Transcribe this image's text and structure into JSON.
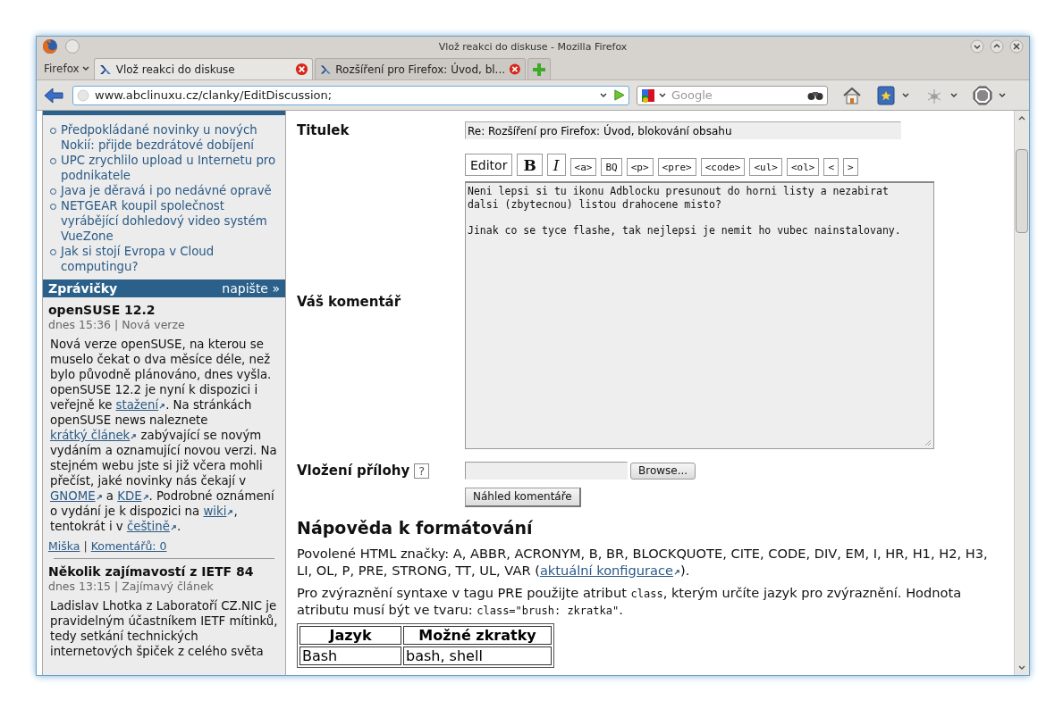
{
  "window": {
    "title": "Vlož reakci do diskuse - Mozilla Firefox"
  },
  "menu_button": "Firefox",
  "tabs": [
    {
      "label": "Vlož reakci do diskuse",
      "selected": true
    },
    {
      "label": "Rozšíření pro Firefox: Úvod, bl...",
      "selected": false
    }
  ],
  "address": "www.abclinuxu.cz/clanky/EditDiscussion;",
  "search": {
    "placeholder": "Google"
  },
  "sidebar": {
    "links": [
      "Předpokládané novinky u nových Nokií: přijde bezdrátové dobíjení",
      "UPC zrychlilo upload u Internetu pro podnikatele",
      "Java je děravá i po nedávné opravě",
      "NETGEAR koupil společnost vyrábějící dohledový video systém VueZone",
      "Jak si stojí Evropa v Cloud computingu?"
    ],
    "section": {
      "title": "Zprávičky",
      "action": "napište »"
    },
    "news": [
      {
        "title": "openSUSE 12.2",
        "meta": "dnes 15:36 | Nová verze",
        "body": [
          {
            "kind": "text",
            "text": "Nová verze openSUSE, na kterou se muselo čekat o dva měsíce déle, než bylo původně plánováno, dnes vyšla. openSUSE 12.2 je nyní k dispozici i veřejně ke "
          },
          {
            "kind": "link",
            "text": "stažení"
          },
          {
            "kind": "text",
            "text": ". Na stránkách openSUSE news naleznete "
          },
          {
            "kind": "link",
            "text": "krátký článek"
          },
          {
            "kind": "text",
            "text": " zabývající se novým vydáním a oznamující novou verzi. Na stejném webu jste si již včera mohli přečíst, jaké novinky nás čekají v "
          },
          {
            "kind": "link",
            "text": "GNOME"
          },
          {
            "kind": "text",
            "text": " a "
          },
          {
            "kind": "link",
            "text": "KDE"
          },
          {
            "kind": "text",
            "text": ". Podrobné oznámení o vydání je k dispozici na "
          },
          {
            "kind": "link",
            "text": "wiki"
          },
          {
            "kind": "text",
            "text": ", tentokrát i v "
          },
          {
            "kind": "link",
            "text": "češtině"
          },
          {
            "kind": "text",
            "text": "."
          }
        ],
        "footer": [
          "Miška",
          "Komentářů: 0"
        ],
        "separator": "|"
      },
      {
        "title": "Několik zajímavostí z IETF 84",
        "meta": "dnes 13:15 | Zajímavý článek",
        "body": [
          {
            "kind": "text",
            "text": "Ladislav Lhotka z Laboratoří CZ.NIC je pravidelným účastníkem IETF mítinků, tedy setkání technických internetových špiček z celého světa"
          }
        ]
      }
    ]
  },
  "form": {
    "title_label": "Titulek",
    "title_value": "Re: Rozšíření pro Firefox: Úvod, blokování obsahu",
    "editor_buttons": [
      {
        "kind": "editor",
        "label": "Editor"
      },
      {
        "kind": "bold",
        "label": "B"
      },
      {
        "kind": "italic",
        "label": "I"
      },
      {
        "kind": "tag",
        "label": "<a>"
      },
      {
        "kind": "tag",
        "label": "BQ"
      },
      {
        "kind": "tag",
        "label": "<p>"
      },
      {
        "kind": "tag",
        "label": "<pre>"
      },
      {
        "kind": "tag",
        "label": "<code>"
      },
      {
        "kind": "tag",
        "label": "<ul>"
      },
      {
        "kind": "tag",
        "label": "<ol>"
      },
      {
        "kind": "tag",
        "label": "<"
      },
      {
        "kind": "tag",
        "label": ">"
      }
    ],
    "comment_label": "Váš komentář",
    "comment_value": "Neni lepsi si tu ikonu Adblocku presunout do horni listy a nezabirat\ndalsi (zbytecnou) listou drahocene misto?\n\nJinak co se tyce flashe, tak nejlepsi je nemit ho vubec nainstalovany.",
    "attachment_label": "Vložení přílohy",
    "help_mark": "?",
    "browse_button": "Browse...",
    "preview_button": "Náhled komentáře"
  },
  "help": {
    "heading": "Nápověda k formátování",
    "paragraphs": [
      [
        {
          "kind": "text",
          "text": "Povolené HTML značky: A, ABBR, ACRONYM, B, BR, BLOCKQUOTE, CITE, CODE, DIV, EM, I, HR, H1, H2, H3, LI, OL, P, PRE, STRONG, TT, UL, VAR ("
        },
        {
          "kind": "link",
          "text": "aktuální konfigurace"
        },
        {
          "kind": "text",
          "text": ")."
        }
      ],
      [
        {
          "kind": "text",
          "text": "Pro zvýraznění syntaxe v tagu PRE použijte atribut "
        },
        {
          "kind": "code",
          "text": "class"
        },
        {
          "kind": "text",
          "text": ", kterým určíte jazyk pro zvýraznění. Hodnota atributu musí být ve tvaru: "
        },
        {
          "kind": "code",
          "text": "class=\"brush: zkratka\""
        },
        {
          "kind": "text",
          "text": "."
        }
      ]
    ],
    "table": {
      "columns": [
        "Jazyk",
        "Možné zkratky"
      ],
      "rows": [
        [
          "Bash",
          "bash, shell"
        ]
      ]
    }
  }
}
